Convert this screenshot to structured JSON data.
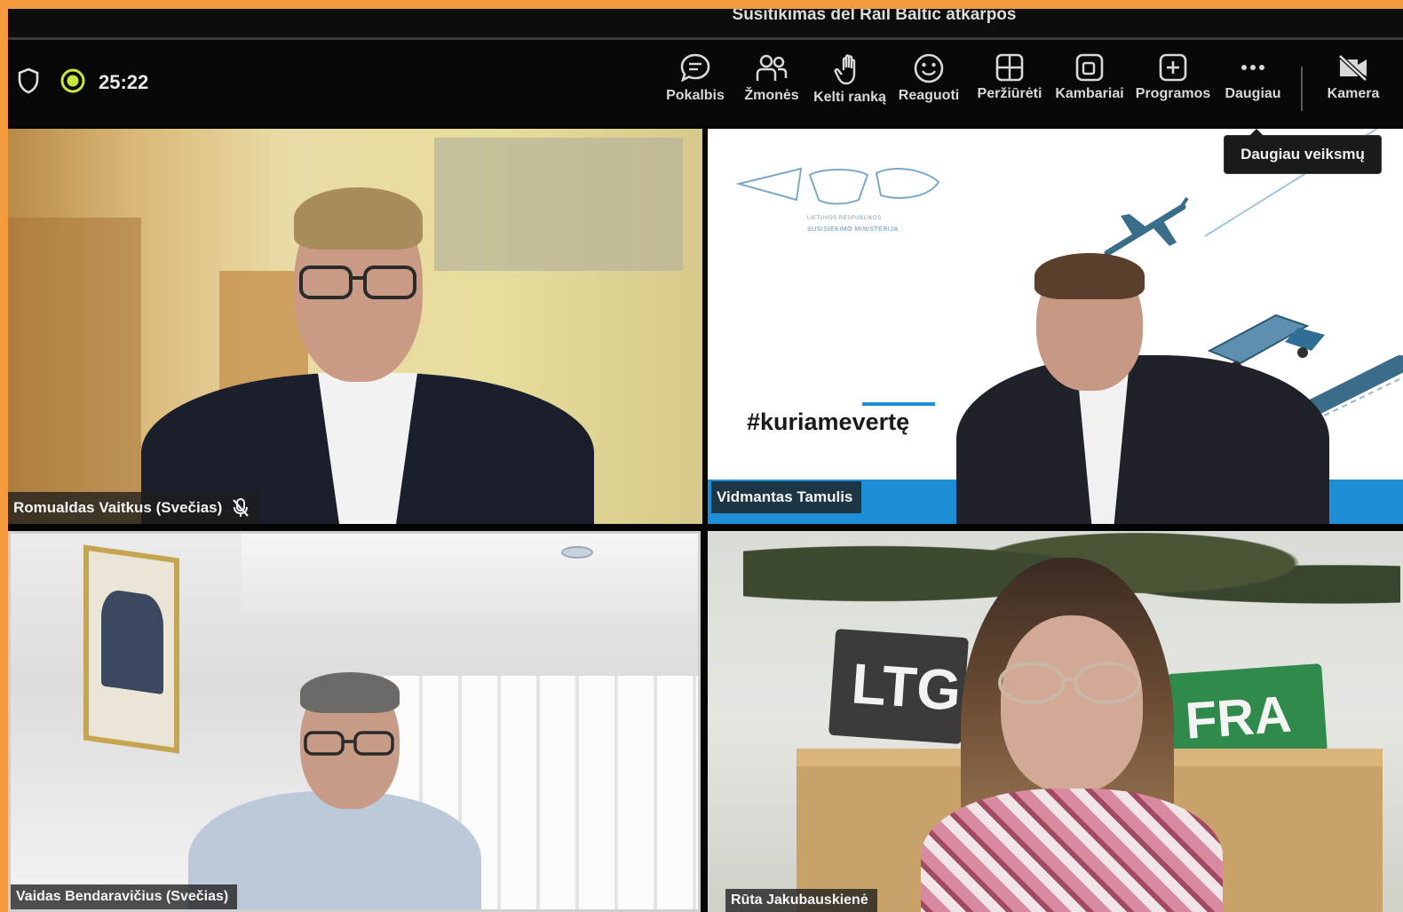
{
  "meeting": {
    "title": "Susitikimas dėl Rail Baltic atkarpos",
    "elapsed": "25:22"
  },
  "toolbar": {
    "items": [
      {
        "label": "Pokalbis",
        "icon": "chat-icon"
      },
      {
        "label": "Žmonės",
        "icon": "people-icon"
      },
      {
        "label": "Kelti ranką",
        "icon": "raise-hand-icon"
      },
      {
        "label": "Reaguoti",
        "icon": "smiley-icon"
      },
      {
        "label": "Peržiūrėti",
        "icon": "grid-view-icon"
      },
      {
        "label": "Kambariai",
        "icon": "rooms-icon"
      },
      {
        "label": "Programos",
        "icon": "add-app-icon"
      },
      {
        "label": "Daugiau",
        "icon": "more-icon"
      },
      {
        "label": "Kamera",
        "icon": "camera-off-icon"
      }
    ],
    "tooltip": "Daugiau veiksmų"
  },
  "participants": [
    {
      "name": "Romualdas Vaitkus (Svečias)",
      "muted": true
    },
    {
      "name": "Vidmantas Tamulis"
    },
    {
      "name": "Vaidas Bendaravičius (Svečias)"
    },
    {
      "name": "Rūta Jakubauskienė"
    }
  ],
  "slide": {
    "hashtag": "#kuriamevertę",
    "ministry_line1": "LIETUVOS RESPUBLIKOS",
    "ministry_line2": "SUSISIEKIMO MINISTERIJA"
  },
  "backdrop_sign": {
    "left_text": "LTG",
    "right_text": "FRA"
  },
  "colors": {
    "border": "#f39a3c",
    "accent_blue": "#1e8fd6",
    "status_dot": "#c8e63c"
  }
}
